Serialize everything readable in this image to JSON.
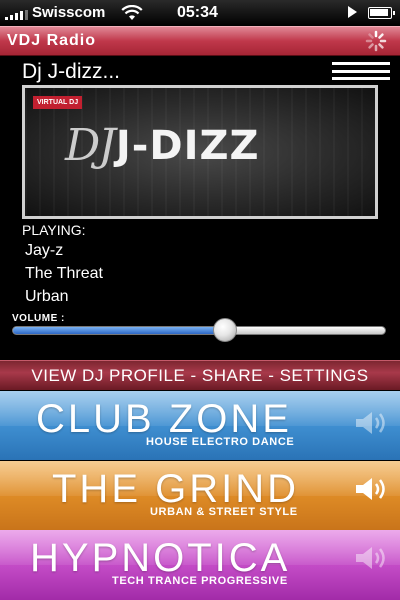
{
  "status_bar": {
    "carrier": "Swisscom",
    "time": "05:34"
  },
  "app": {
    "title": "VDJ Radio"
  },
  "dj": {
    "name": "Dj J-dizz...",
    "banner_badge": "VIRTUAL DJ",
    "banner_logo_prefix": "DJ",
    "banner_logo_name": "J-DIZZ"
  },
  "now_playing": {
    "label": "PLAYING:",
    "artist": "Jay-z",
    "title": "The Threat",
    "genre": "Urban"
  },
  "volume": {
    "label": "VOLUME :",
    "level_percent": 57
  },
  "profile_bar": {
    "text": "VIEW DJ PROFILE - SHARE - SETTINGS"
  },
  "stations": [
    {
      "name": "CLUB ZONE",
      "subtitle": "HOUSE ELECTRO DANCE",
      "color": "#3f8fd1",
      "speaker_active": false
    },
    {
      "name": "THE GRIND",
      "subtitle": "URBAN & STREET STYLE",
      "color": "#de8b26",
      "speaker_active": true
    },
    {
      "name": "HYPNOTICA",
      "subtitle": "TECH TRANCE PROGRESSIVE",
      "color": "#c44cc7",
      "speaker_active": false
    }
  ],
  "icons": {
    "signal": "signal-bars-icon",
    "wifi": "wifi-icon",
    "play": "play-indicator-icon",
    "battery": "battery-icon",
    "loading": "loading-spinner-icon",
    "menu": "menu-icon",
    "speaker": "speaker-icon"
  }
}
